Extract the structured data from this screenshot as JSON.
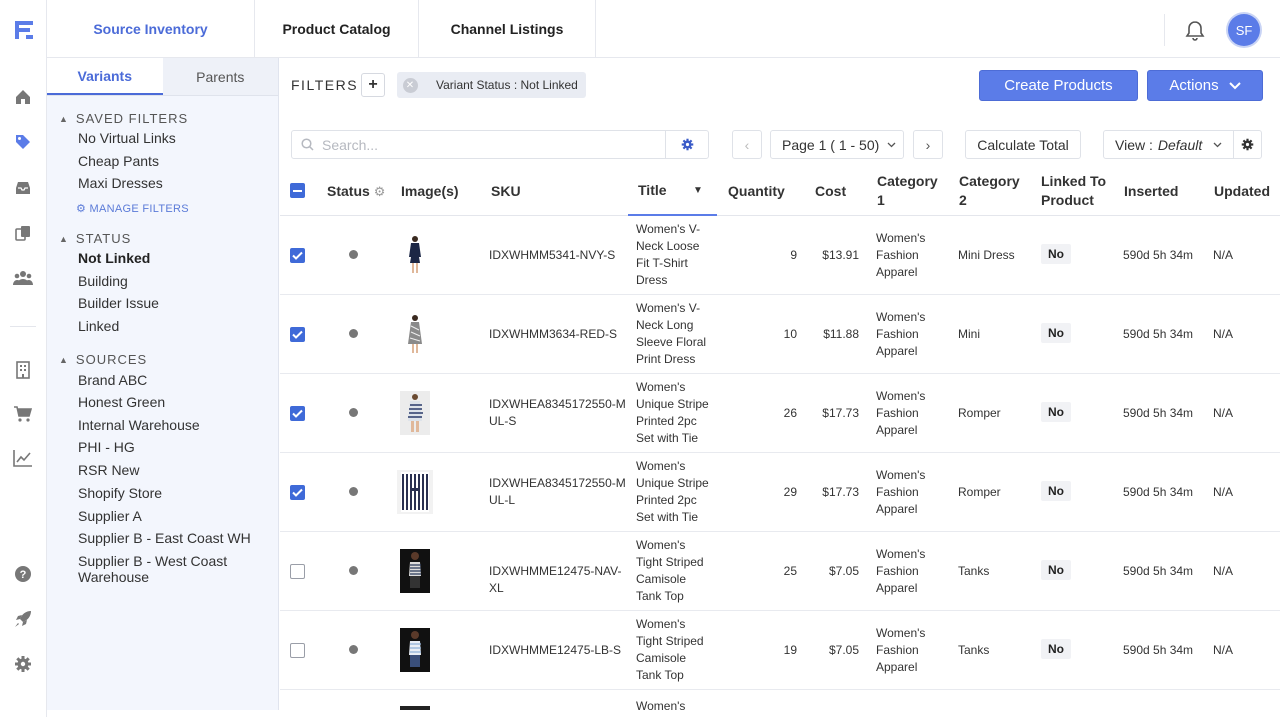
{
  "topnav": {
    "tabs": [
      "Source Inventory",
      "Product Catalog",
      "Channel Listings"
    ],
    "active_tab": "Source Inventory",
    "avatar_initials": "SF"
  },
  "sidebar": {
    "tabs": [
      "Variants",
      "Parents"
    ],
    "active_tab": "Variants",
    "saved_filters": {
      "heading": "SAVED FILTERS",
      "items": [
        "No Virtual Links",
        "Cheap Pants",
        "Maxi Dresses"
      ],
      "manage_label": "MANAGE FILTERS"
    },
    "status": {
      "heading": "STATUS",
      "items": [
        "Not Linked",
        "Building",
        "Builder Issue",
        "Linked"
      ],
      "selected": "Not Linked"
    },
    "sources": {
      "heading": "SOURCES",
      "items": [
        "Brand ABC",
        "Honest Green",
        "Internal Warehouse",
        "PHI - HG",
        "RSR New",
        "Shopify Store",
        "Supplier A",
        "Supplier B - East Coast WH",
        "Supplier B - West Coast Warehouse"
      ]
    }
  },
  "toolbar": {
    "filters_label": "FILTERS",
    "add_filter": "+",
    "active_filter_chip": "Variant Status : Not Linked",
    "create_products_label": "Create Products",
    "actions_label": "Actions",
    "search_placeholder": "Search...",
    "page_label": "Page 1 ( 1 - 50)",
    "calculate_total_label": "Calculate Total",
    "view_prefix": "View :",
    "view_value": "Default"
  },
  "table": {
    "columns": [
      "Status",
      "Image(s)",
      "SKU",
      "Title",
      "Quantity",
      "Cost",
      "Category 1",
      "Category 2",
      "Linked To Product",
      "Inserted",
      "Updated"
    ],
    "rows": [
      {
        "checked": true,
        "sku": "IDXWHMM5341-NVY-S",
        "title": "Women's V-Neck Loose Fit T-Shirt Dress",
        "quantity": "9",
        "cost": "$13.91",
        "category1": "Women's Fashion Apparel",
        "category2": "Mini Dress",
        "linked": "No",
        "inserted": "590d 5h 34m",
        "updated": "N/A"
      },
      {
        "checked": true,
        "sku": "IDXWHMM3634-RED-S",
        "title": "Women's V-Neck Long Sleeve Floral Print Dress",
        "quantity": "10",
        "cost": "$11.88",
        "category1": "Women's Fashion Apparel",
        "category2": "Mini",
        "linked": "No",
        "inserted": "590d 5h 34m",
        "updated": "N/A"
      },
      {
        "checked": true,
        "sku": "IDXWHEA8345172550-MUL-S",
        "title": "Women's Unique Stripe Printed 2pc Set with Tie",
        "quantity": "26",
        "cost": "$17.73",
        "category1": "Women's Fashion Apparel",
        "category2": "Romper",
        "linked": "No",
        "inserted": "590d 5h 34m",
        "updated": "N/A"
      },
      {
        "checked": true,
        "sku": "IDXWHEA8345172550-MUL-L",
        "title": "Women's Unique Stripe Printed 2pc Set with Tie",
        "quantity": "29",
        "cost": "$17.73",
        "category1": "Women's Fashion Apparel",
        "category2": "Romper",
        "linked": "No",
        "inserted": "590d 5h 34m",
        "updated": "N/A"
      },
      {
        "checked": false,
        "sku": "IDXWHMME12475-NAV-XL",
        "title": "Women's Tight Striped Camisole Tank Top",
        "quantity": "25",
        "cost": "$7.05",
        "category1": "Women's Fashion Apparel",
        "category2": "Tanks",
        "linked": "No",
        "inserted": "590d 5h 34m",
        "updated": "N/A"
      },
      {
        "checked": false,
        "sku": "IDXWHMME12475-LB-S",
        "title": "Women's Tight Striped Camisole Tank Top",
        "quantity": "19",
        "cost": "$7.05",
        "category1": "Women's Fashion Apparel",
        "category2": "Tanks",
        "linked": "No",
        "inserted": "590d 5h 34m",
        "updated": "N/A"
      }
    ],
    "partial_next_row_title": "Women's"
  },
  "colors": {
    "accent": "#5b7ce8",
    "checkbox": "#3f6ad8",
    "sidebar_bg": "#f3f6fd"
  }
}
